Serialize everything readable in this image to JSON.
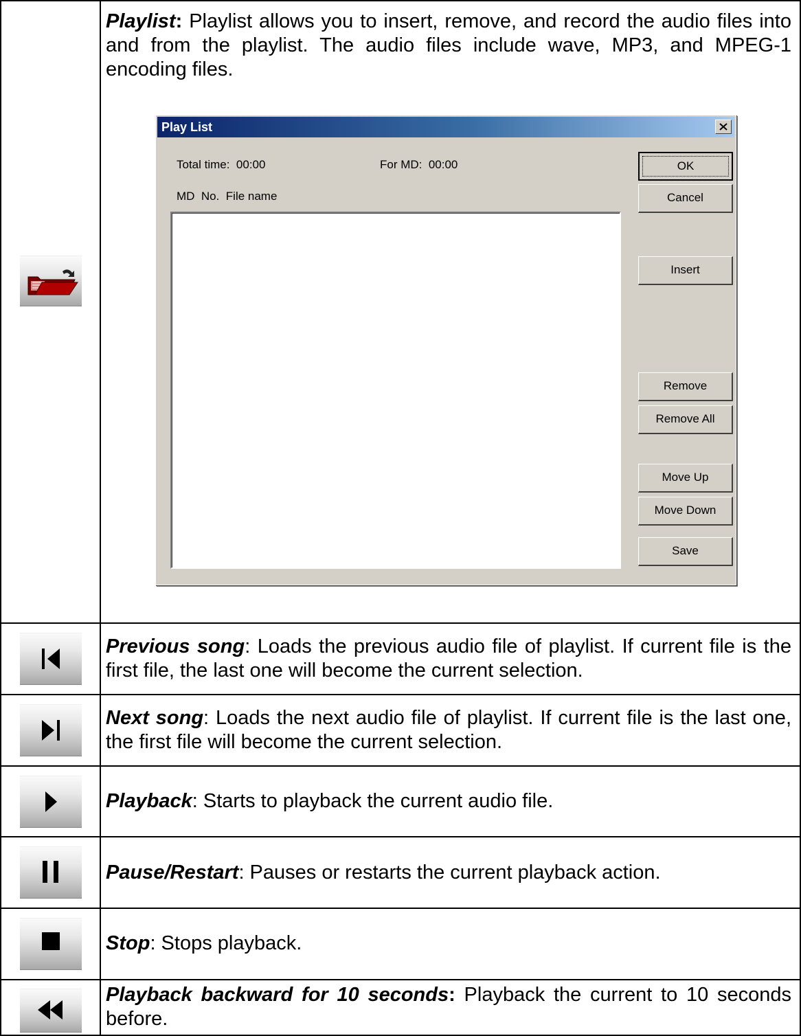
{
  "rows": [
    {
      "icon": "open-folder-icon",
      "title": "Playlist",
      "title_suffix": ":",
      "text": " Playlist allows you to insert, remove, and record the audio files into and from the playlist. The audio files include wave, MP3, and MPEG-1 encoding files."
    },
    {
      "icon": "previous-track-icon",
      "title": "Previous song",
      "title_suffix": "",
      "text": ": Loads the previous audio file of playlist. If current file is the first file, the last one will become the current selection."
    },
    {
      "icon": "next-track-icon",
      "title": "Next song",
      "title_suffix": "",
      "text": ": Loads the next audio file of playlist. If current file is the last one, the first file will become the current selection."
    },
    {
      "icon": "play-icon",
      "title": "Playback",
      "title_suffix": "",
      "text": ": Starts to playback the current audio file."
    },
    {
      "icon": "pause-icon",
      "title": "Pause/Restart",
      "title_suffix": "",
      "text": ": Pauses or restarts the current playback action."
    },
    {
      "icon": "stop-icon",
      "title": "Stop",
      "title_suffix": "",
      "text": ": Stops playback."
    },
    {
      "icon": "rewind-icon",
      "title": "Playback backward for 10 seconds",
      "title_suffix": ":",
      "text": " Playback the current to 10 seconds before."
    }
  ],
  "dialog": {
    "title": "Play List",
    "total_time": "Total time:  00:00",
    "for_md": "For MD:  00:00",
    "columns": "MD  No.  File name",
    "buttons": {
      "ok": "OK",
      "cancel": "Cancel",
      "insert": "Insert",
      "remove": "Remove",
      "remove_all": "Remove All",
      "move_up": "Move Up",
      "move_down": "Move Down",
      "save": "Save"
    },
    "colors": {
      "titlebar_start": "#0a246a",
      "titlebar_end": "#a6caf0",
      "face": "#d4d0c8"
    }
  }
}
